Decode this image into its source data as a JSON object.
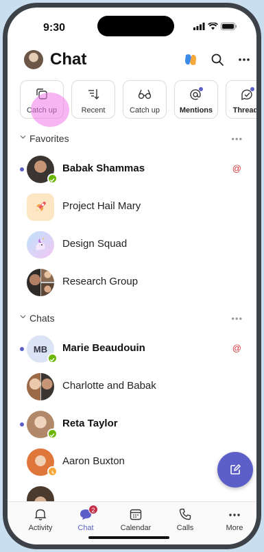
{
  "status": {
    "time": "9:30"
  },
  "header": {
    "title": "Chat"
  },
  "filters": [
    {
      "label": "Catch up",
      "icon": "copy-stack-icon",
      "bold": false
    },
    {
      "label": "Recent",
      "icon": "sort-down-icon",
      "bold": false
    },
    {
      "label": "Catch up",
      "icon": "glasses-icon",
      "bold": false
    },
    {
      "label": "Mentions",
      "icon": "at-icon",
      "bold": true
    },
    {
      "label": "Threads",
      "icon": "threads-icon",
      "bold": true
    }
  ],
  "sections": {
    "favorites": {
      "label": "Favorites",
      "rows": [
        {
          "name": "Babak Shammas",
          "unread": true,
          "mention": "@",
          "status": "available"
        },
        {
          "name": "Project Hail Mary",
          "unread": false,
          "mention": "",
          "status": ""
        },
        {
          "name": "Design Squad",
          "unread": false,
          "mention": "",
          "status": ""
        },
        {
          "name": "Research Group",
          "unread": false,
          "mention": "",
          "status": ""
        }
      ]
    },
    "chats": {
      "label": "Chats",
      "rows": [
        {
          "name": "Marie Beaudouin",
          "initials": "MB",
          "unread": true,
          "mention": "@",
          "status": "available"
        },
        {
          "name": "Charlotte and Babak",
          "unread": false,
          "mention": "",
          "status": ""
        },
        {
          "name": "Reta Taylor",
          "unread": true,
          "mention": "",
          "status": "available"
        },
        {
          "name": "Aaron Buxton",
          "unread": false,
          "mention": "",
          "status": "away"
        }
      ]
    }
  },
  "tabs": [
    {
      "label": "Activity",
      "icon": "bell-icon"
    },
    {
      "label": "Chat",
      "icon": "chat-icon",
      "count": "2",
      "active": true
    },
    {
      "label": "Calendar",
      "icon": "calendar-icon"
    },
    {
      "label": "Calls",
      "icon": "phone-icon"
    },
    {
      "label": "More",
      "icon": "more-icon"
    }
  ],
  "colors": {
    "accent": "#5b5fc7",
    "available": "#6bb700",
    "away": "#f8a73b",
    "mention": "#d13438",
    "highlight": "#f278eb"
  }
}
